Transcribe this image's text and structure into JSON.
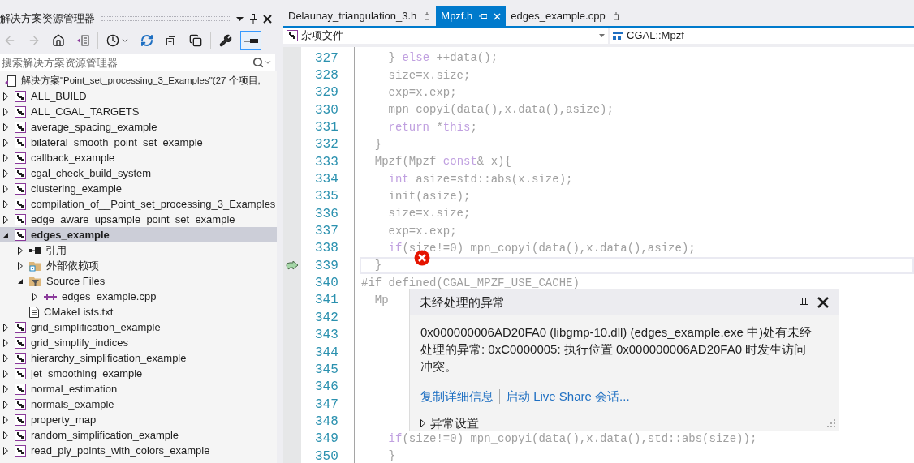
{
  "explorer": {
    "title": "解决方案资源管理器",
    "toolbar": [
      {
        "kind": "back",
        "disabled": true,
        "selected": false
      },
      {
        "kind": "forward",
        "disabled": true,
        "selected": false
      },
      {
        "kind": "home",
        "selected": false
      },
      {
        "kind": "solution",
        "selected": false
      },
      {
        "kind": "history",
        "selected": false
      },
      {
        "kind": "sync",
        "selected": false
      },
      {
        "kind": "collapse",
        "selected": false
      },
      {
        "kind": "copy",
        "selected": false
      },
      {
        "kind": "wrench",
        "selected": false
      },
      {
        "kind": "preview",
        "selected": true
      }
    ],
    "search": {
      "placeholder": "搜索解决方案资源管理器"
    },
    "solution": "解决方案\"Point_set_processing_3_Examples\"(27 个项目,",
    "tree": [
      {
        "label": "ALL_BUILD",
        "kind": "project",
        "expanded": false,
        "selected": false
      },
      {
        "label": "ALL_CGAL_TARGETS",
        "kind": "project",
        "expanded": false,
        "selected": false
      },
      {
        "label": "average_spacing_example",
        "kind": "project",
        "expanded": false,
        "selected": false
      },
      {
        "label": "bilateral_smooth_point_set_example",
        "kind": "project",
        "expanded": false,
        "selected": false
      },
      {
        "label": "callback_example",
        "kind": "project",
        "expanded": false,
        "selected": false
      },
      {
        "label": "cgal_check_build_system",
        "kind": "project",
        "expanded": false,
        "selected": false
      },
      {
        "label": "clustering_example",
        "kind": "project",
        "expanded": false,
        "selected": false
      },
      {
        "label": "compilation_of__Point_set_processing_3_Examples",
        "kind": "project",
        "expanded": false,
        "selected": false
      },
      {
        "label": "edge_aware_upsample_point_set_example",
        "kind": "project",
        "expanded": false,
        "selected": false
      },
      {
        "label": "edges_example",
        "kind": "project",
        "expanded": true,
        "selected": true,
        "children": [
          {
            "label": "引用",
            "kind": "references",
            "expanded": false,
            "selected": false
          },
          {
            "label": "外部依赖项",
            "kind": "folder",
            "expanded": false,
            "selected": false
          },
          {
            "label": "Source Files",
            "kind": "filter",
            "expanded": true,
            "selected": false,
            "children": [
              {
                "label": "edges_example.cpp",
                "kind": "cpp",
                "expanded": false,
                "selected": false
              }
            ]
          },
          {
            "label": "CMakeLists.txt",
            "kind": "text",
            "selected": false
          }
        ]
      },
      {
        "label": "grid_simplification_example",
        "kind": "project",
        "expanded": false,
        "selected": false
      },
      {
        "label": "grid_simplify_indices",
        "kind": "project",
        "expanded": false,
        "selected": false
      },
      {
        "label": "hierarchy_simplification_example",
        "kind": "project",
        "expanded": false,
        "selected": false
      },
      {
        "label": "jet_smoothing_example",
        "kind": "project",
        "expanded": false,
        "selected": false
      },
      {
        "label": "normal_estimation",
        "kind": "project",
        "expanded": false,
        "selected": false
      },
      {
        "label": "normals_example",
        "kind": "project",
        "expanded": false,
        "selected": false
      },
      {
        "label": "property_map",
        "kind": "project",
        "expanded": false,
        "selected": false
      },
      {
        "label": "random_simplification_example",
        "kind": "project",
        "expanded": false,
        "selected": false
      },
      {
        "label": "read_ply_points_with_colors_example",
        "kind": "project",
        "expanded": false,
        "selected": false
      }
    ]
  },
  "editor": {
    "tabs": [
      {
        "label": "Delaunay_triangulation_3.h",
        "selected": false,
        "closable": false
      },
      {
        "label": "Mpzf.h",
        "selected": true,
        "closable": true
      },
      {
        "label": "edges_example.cpp",
        "selected": false,
        "closable": false
      }
    ],
    "project_dropdown": "杂项文件",
    "scope_dropdown": "CGAL::Mpzf",
    "lines": [
      {
        "number": "327",
        "current": false,
        "code": [
          {
            "kind": "plain",
            "text": "    } "
          },
          {
            "kind": "keyword",
            "text": "else"
          },
          {
            "kind": "plain",
            "text": " ++data();"
          }
        ]
      },
      {
        "number": "328",
        "current": false,
        "code": [
          {
            "kind": "plain",
            "text": "    size=x.size;"
          }
        ]
      },
      {
        "number": "329",
        "current": false,
        "code": [
          {
            "kind": "plain",
            "text": "    exp=x.exp;"
          }
        ]
      },
      {
        "number": "330",
        "current": false,
        "code": [
          {
            "kind": "plain",
            "text": "    mpn_copyi(data(),x.data(),asize);"
          }
        ]
      },
      {
        "number": "331",
        "current": false,
        "code": [
          {
            "kind": "keyword",
            "text": "    return"
          },
          {
            "kind": "plain",
            "text": " *"
          },
          {
            "kind": "keyword",
            "text": "this"
          },
          {
            "kind": "plain",
            "text": ";"
          }
        ]
      },
      {
        "number": "332",
        "current": false,
        "code": [
          {
            "kind": "plain",
            "text": "  }"
          }
        ]
      },
      {
        "number": "333",
        "current": false,
        "code": [
          {
            "kind": "plain",
            "text": "  Mpzf(Mpzf "
          },
          {
            "kind": "keyword",
            "text": "const"
          },
          {
            "kind": "plain",
            "text": "& x){"
          }
        ]
      },
      {
        "number": "334",
        "current": false,
        "code": [
          {
            "kind": "keyword",
            "text": "    int"
          },
          {
            "kind": "plain",
            "text": " asize=std::abs(x.size);"
          }
        ]
      },
      {
        "number": "335",
        "current": false,
        "code": [
          {
            "kind": "plain",
            "text": "    init(asize);"
          }
        ]
      },
      {
        "number": "336",
        "current": false,
        "code": [
          {
            "kind": "plain",
            "text": "    size=x.size;"
          }
        ]
      },
      {
        "number": "337",
        "current": false,
        "code": [
          {
            "kind": "plain",
            "text": "    exp=x.exp;"
          }
        ]
      },
      {
        "number": "338",
        "current": false,
        "code": [
          {
            "kind": "keyword",
            "text": "    if"
          },
          {
            "kind": "plain",
            "text": "(size!=0) mpn_copyi(data(),x.data(),asize);"
          }
        ]
      },
      {
        "number": "339",
        "current": true,
        "code": [
          {
            "kind": "plain",
            "text": "  }"
          }
        ]
      },
      {
        "number": "340",
        "current": false,
        "code": [
          {
            "kind": "plain",
            "text": "#if defined(CGAL_MPZF_USE_CACHE)"
          }
        ]
      },
      {
        "number": "341",
        "current": false,
        "code": [
          {
            "kind": "plain",
            "text": "  Mp"
          }
        ]
      },
      {
        "number": "342",
        "current": false
      },
      {
        "number": "343",
        "current": false
      },
      {
        "number": "344",
        "current": false
      },
      {
        "number": "345",
        "current": false
      },
      {
        "number": "346",
        "current": false
      },
      {
        "number": "347",
        "current": false
      },
      {
        "number": "348",
        "current": false
      },
      {
        "number": "349",
        "current": false,
        "code": [
          {
            "kind": "keyword",
            "text": "    if"
          },
          {
            "kind": "plain",
            "text": "(size!=0) mpn_copyi(data(),x.data(),std::abs(size));"
          }
        ]
      },
      {
        "number": "350",
        "current": false,
        "code": [
          {
            "kind": "plain",
            "text": "    }"
          }
        ]
      }
    ]
  },
  "exception_popup": {
    "title": "未经处理的异常",
    "message": "0x000000006AD20FA0 (libgmp-10.dll) (edges_example.exe 中)处有未经处理的异常: 0xC0000005: 执行位置 0x000000006AD20FA0 时发生访问冲突。",
    "links": [
      "复制详细信息",
      "启动 Live Share 会话..."
    ],
    "settings": {
      "label": "异常设置",
      "expanded": false
    }
  }
}
